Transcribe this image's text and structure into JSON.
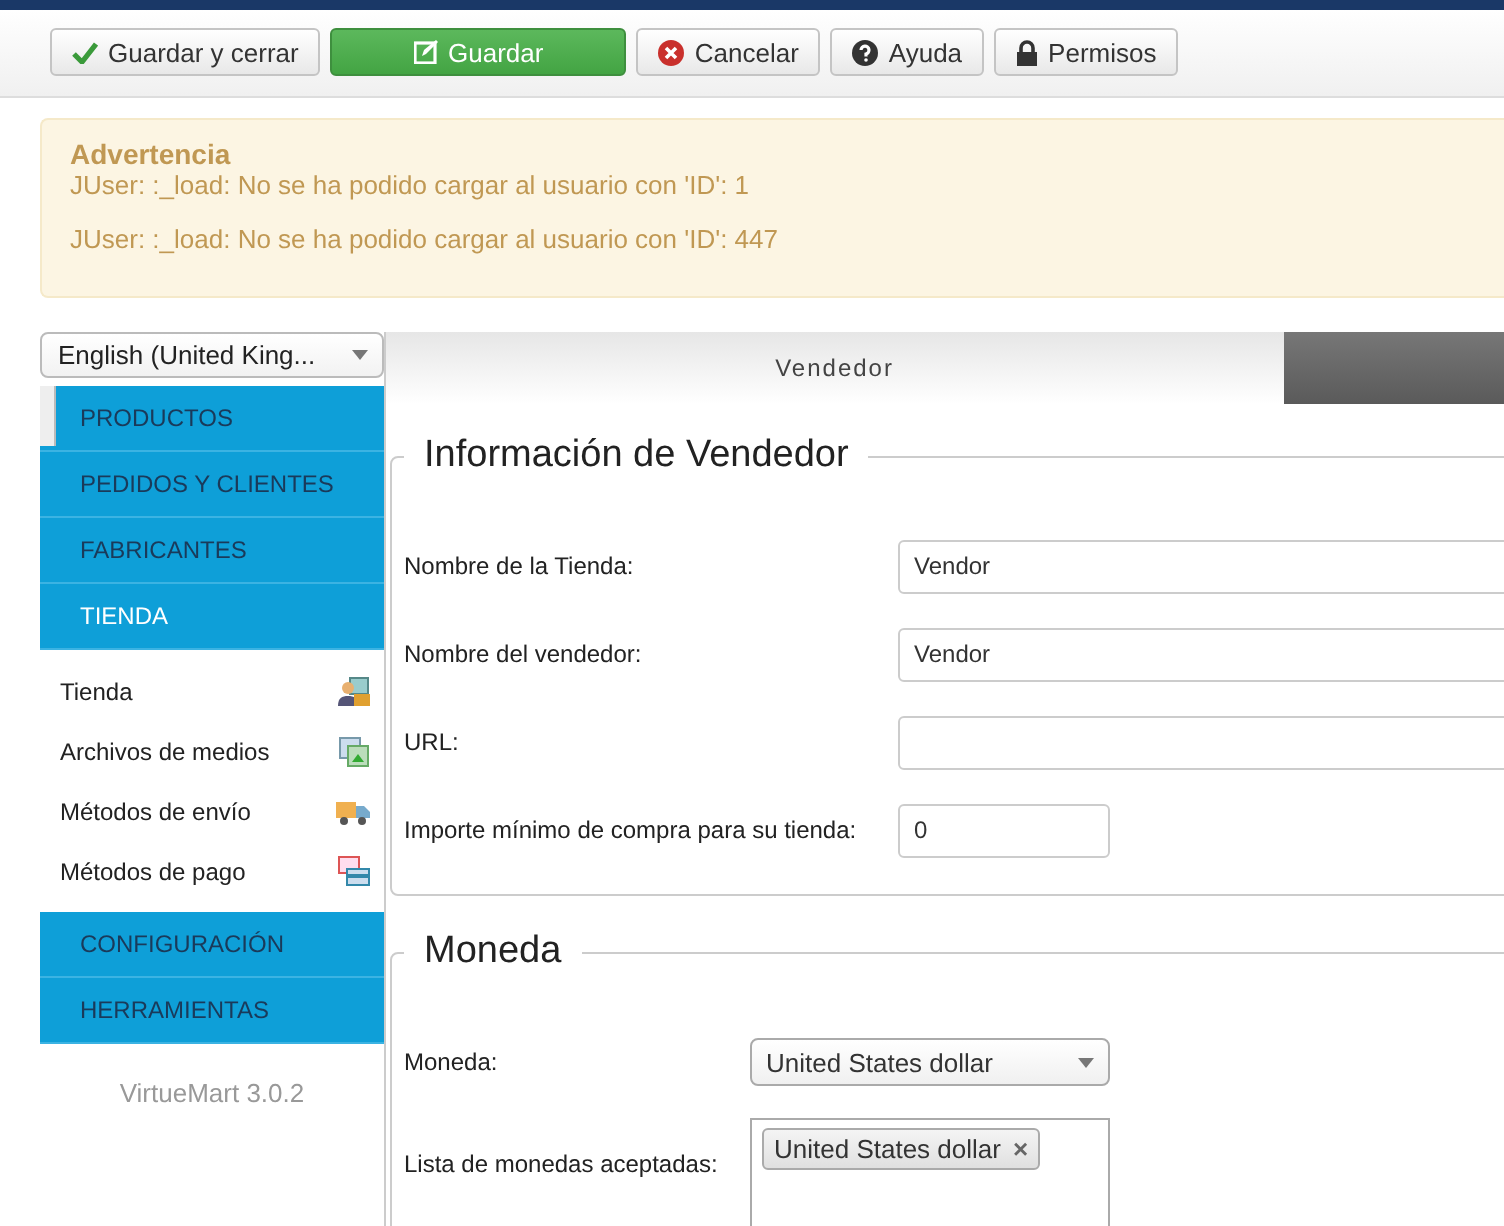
{
  "toolbar": {
    "buttons": [
      {
        "label": "Guardar y cerrar",
        "kind": "save-close"
      },
      {
        "label": "Guardar",
        "kind": "save"
      },
      {
        "label": "Cancelar",
        "kind": "cancel"
      },
      {
        "label": "Ayuda",
        "kind": "help"
      },
      {
        "label": "Permisos",
        "kind": "permissions"
      }
    ]
  },
  "alert": {
    "title": "Advertencia",
    "messages": [
      "JUser: :_load: No se ha podido cargar al usuario con 'ID': 1",
      "JUser: :_load: No se ha podido cargar al usuario con 'ID': 447"
    ]
  },
  "sidebar": {
    "language": "English (United King...",
    "items": [
      {
        "label": "PRODUCTOS",
        "expanded": false
      },
      {
        "label": "PEDIDOS Y CLIENTES",
        "expanded": false
      },
      {
        "label": "FABRICANTES",
        "expanded": false
      },
      {
        "label": "TIENDA",
        "expanded": true,
        "children": [
          {
            "label": "Tienda",
            "kind": "store"
          },
          {
            "label": "Archivos de medios",
            "kind": "media"
          },
          {
            "label": "Métodos de envío",
            "kind": "shipping"
          },
          {
            "label": "Métodos de pago",
            "kind": "payment"
          }
        ]
      },
      {
        "label": "CONFIGURACIÓN",
        "expanded": false
      },
      {
        "label": "HERRAMIENTAS",
        "expanded": false
      }
    ],
    "version": "VirtueMart 3.0.2"
  },
  "tabs": [
    {
      "label": "Vendedor",
      "selected": true
    },
    {
      "selected": false
    }
  ],
  "sections": [
    {
      "title": "Información de Vendedor",
      "fields": [
        {
          "label": "Nombre de la Tienda:",
          "kind": "text",
          "value": "Vendor"
        },
        {
          "label": "Nombre del vendedor:",
          "kind": "text",
          "value": "Vendor"
        },
        {
          "label": "URL:",
          "kind": "text"
        },
        {
          "label": "Importe mínimo de compra para su tienda:",
          "kind": "number",
          "value": "0"
        }
      ]
    },
    {
      "title": "Moneda",
      "fields": [
        {
          "label": "Moneda:",
          "kind": "select",
          "value": "United States dollar"
        },
        {
          "label": "Lista de monedas aceptadas:",
          "kind": "tags",
          "tags": [
            {
              "label": "United States dollar",
              "remove": "×"
            }
          ]
        }
      ]
    }
  ]
}
